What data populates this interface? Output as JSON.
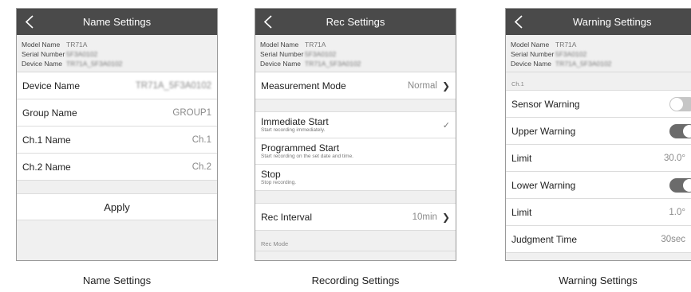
{
  "name_settings": {
    "title": "Name Settings",
    "info": [
      {
        "label": "Model Name",
        "value": "TR71A"
      },
      {
        "label": "Serial Number",
        "value": "5F3A0102"
      },
      {
        "label": "Device Name",
        "value": "TR71A_5F3A0102"
      }
    ],
    "rows": [
      {
        "label": "Device Name",
        "value": "TR71A_5F3A0102"
      },
      {
        "label": "Group Name",
        "value": "GROUP1"
      },
      {
        "label": "Ch.1 Name",
        "value": "Ch.1"
      },
      {
        "label": "Ch.2 Name",
        "value": "Ch.2"
      }
    ],
    "apply_label": "Apply",
    "caption": "Name Settings"
  },
  "rec_settings": {
    "title": "Rec Settings",
    "info": [
      {
        "label": "Model Name",
        "value": "TR71A"
      },
      {
        "label": "Serial Number",
        "value": "5F3A0102"
      },
      {
        "label": "Device Name",
        "value": "TR71A_5F3A0102"
      }
    ],
    "measurement_mode": {
      "label": "Measurement Mode",
      "value": "Normal"
    },
    "start_options": [
      {
        "label": "Immediate Start",
        "sub": "Start recording immediately.",
        "selected": true
      },
      {
        "label": "Programmed Start",
        "sub": "Start recording on the set date and time.",
        "selected": false
      },
      {
        "label": "Stop",
        "sub": "Stop recording.",
        "selected": false
      }
    ],
    "rec_interval": {
      "label": "Rec Interval",
      "value": "10min"
    },
    "rec_mode_label": "Rec Mode",
    "caption": "Recording Settings"
  },
  "warning_settings": {
    "title": "Warning Settings",
    "info": [
      {
        "label": "Model Name",
        "value": "TR71A"
      },
      {
        "label": "Serial Number",
        "value": "5F3A0102"
      },
      {
        "label": "Device Name",
        "value": "TR71A_5F3A0102"
      }
    ],
    "section_label": "Ch.1",
    "sensor_warning": {
      "label": "Sensor Warning",
      "on": false
    },
    "upper_warning": {
      "label": "Upper Warning",
      "on": true
    },
    "upper_limit": {
      "label": "Limit",
      "value": "30.0°"
    },
    "lower_warning": {
      "label": "Lower Warning",
      "on": true
    },
    "lower_limit": {
      "label": "Limit",
      "value": "1.0°"
    },
    "judgment_time": {
      "label": "Judgment Time",
      "value": "30sec"
    },
    "caption": "Warning Settings"
  },
  "icons": {
    "back": "chevron-left-icon",
    "chevron": "chevron-right-icon",
    "check": "checkmark-icon"
  },
  "colors": {
    "titlebar": "#4a4a4a",
    "toggle_on": "#6b6b6b",
    "toggle_off": "#c6c6c6",
    "background": "#f0f0f0"
  }
}
